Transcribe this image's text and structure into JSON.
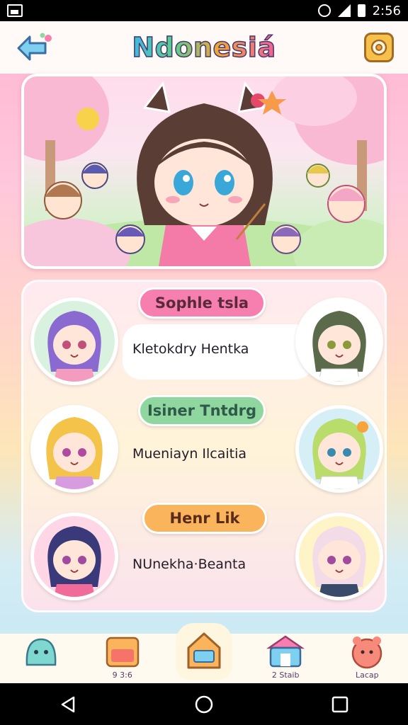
{
  "status_bar": {
    "time": "2:56"
  },
  "header": {
    "title": "Ndonesiá"
  },
  "cards": [
    {
      "name": "Sophle tsla",
      "subtitle": "Kletokdry Hentka",
      "pill_color": "#f77fb0"
    },
    {
      "name": "Isiner Tntdrg",
      "subtitle": "Mueniayn Ilcaitia",
      "pill_color": "#8fd79f"
    },
    {
      "name": "Henr Lik",
      "subtitle": "NUnekha·Beanta",
      "pill_color": "#f9b45c"
    }
  ],
  "bottom_nav": [
    {
      "icon": "slime-icon",
      "label": ""
    },
    {
      "icon": "furniture-icon",
      "label": "9 3:6"
    },
    {
      "icon": "home-icon",
      "label": ""
    },
    {
      "icon": "shop-icon",
      "label": "2 Staib"
    },
    {
      "icon": "pet-icon",
      "label": "Lacap"
    }
  ],
  "colors": {
    "accent_pink": "#f77fb0",
    "accent_green": "#8fd79f",
    "accent_orange": "#f9b45c"
  }
}
